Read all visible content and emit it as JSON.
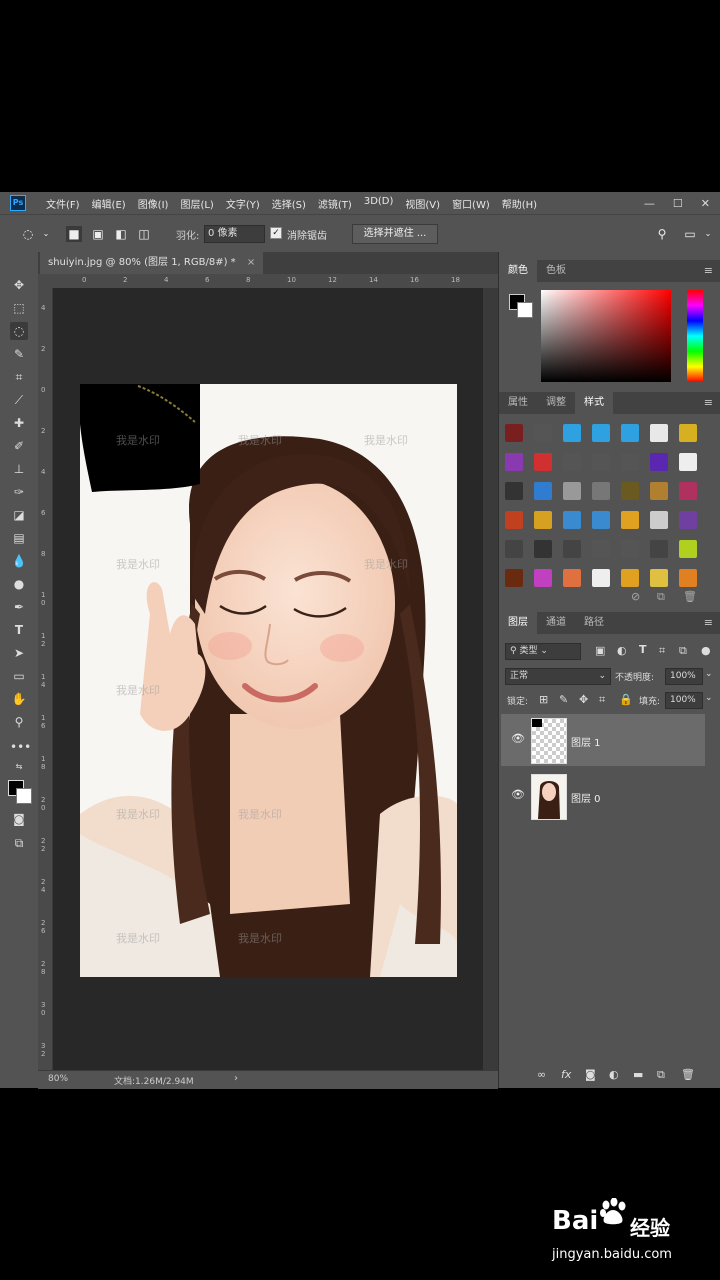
{
  "app": {
    "logo": "Ps"
  },
  "menus": [
    "文件(F)",
    "编辑(E)",
    "图像(I)",
    "图层(L)",
    "文字(Y)",
    "选择(S)",
    "滤镜(T)",
    "3D(D)",
    "视图(V)",
    "窗口(W)",
    "帮助(H)"
  ],
  "window_controls": {
    "minimize": "—",
    "maximize": "☐",
    "close": "✕"
  },
  "options": {
    "feather_label": "羽化:",
    "feather_value": "0 像素",
    "antialias_label": "消除锯齿",
    "antialias_checked": true,
    "select_mask_button": "选择并遮住 ..."
  },
  "document": {
    "tab_title": "shuiyin.jpg @ 80% (图层 1, RGB/8#) *",
    "close": "×",
    "ruler_top": [
      "0",
      "2",
      "4",
      "6",
      "8",
      "10",
      "12",
      "14",
      "16",
      "18"
    ],
    "ruler_left": [
      "4",
      "2",
      "0",
      "2",
      "4",
      "6",
      "8",
      "1\n0",
      "1\n2",
      "1\n4",
      "1\n6",
      "1\n8",
      "2\n0",
      "2\n2",
      "2\n4",
      "2\n6",
      "2\n8",
      "3\n0",
      "3\n2"
    ],
    "watermark_text": "我是水印"
  },
  "status": {
    "zoom": "80%",
    "doc_info": "文档:1.26M/2.94M",
    "arrow": "›"
  },
  "panels": {
    "color_tabs": [
      "颜色",
      "色板"
    ],
    "style_tabs": [
      "属性",
      "调整",
      "样式"
    ],
    "layer_tabs": [
      "图层",
      "通道",
      "路径"
    ],
    "kind_filter": "类型",
    "blend_mode": "正常",
    "opacity_label": "不透明度:",
    "opacity_value": "100%",
    "lock_label": "锁定:",
    "fill_label": "填充:",
    "fill_value": "100%",
    "layers": [
      {
        "name": "图层 1",
        "selected": true
      },
      {
        "name": "图层 0",
        "selected": false
      }
    ]
  },
  "watermark": {
    "brand": "Bai",
    "brand_cn": "经验",
    "url": "jingyan.baidu.com"
  },
  "colors": {
    "fg": "#000000",
    "bg": "#ffffff",
    "accent": "#31a8ff"
  }
}
